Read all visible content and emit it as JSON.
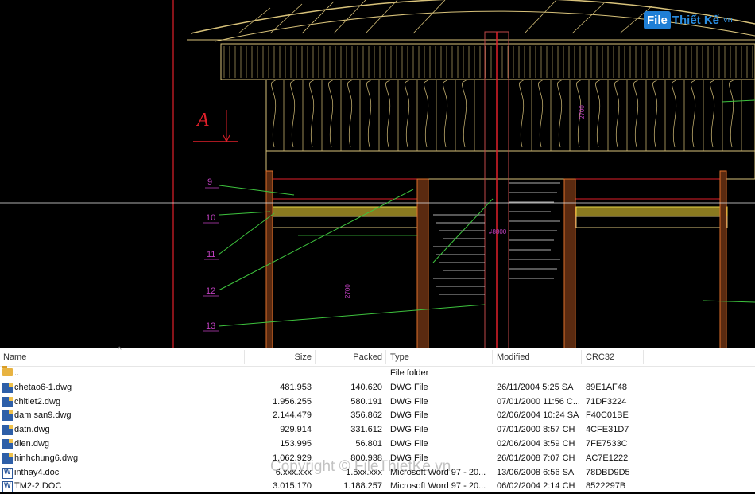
{
  "cad": {
    "section_label": "A",
    "callouts": [
      "9",
      "10",
      "11",
      "12",
      "13"
    ],
    "dim_texts": [
      "2700",
      "2700",
      "#8800"
    ],
    "colors": {
      "background": "#000000",
      "structure": "#d8c27a",
      "red": "#e0202a",
      "green": "#3ec43e",
      "white": "#e8e8e8",
      "magenta": "#c040c0"
    }
  },
  "logo": {
    "box": "File",
    "name": "Thiết Kế",
    "domain": ".vn"
  },
  "file_list": {
    "headers": {
      "name": "Name",
      "size": "Size",
      "packed": "Packed",
      "type": "Type",
      "modified": "Modified",
      "crc": "CRC32"
    },
    "rows": [
      {
        "icon": "folder-icon",
        "name": "..",
        "size": "",
        "packed": "",
        "type": "File folder",
        "modified": "",
        "crc": ""
      },
      {
        "icon": "dwg-icon",
        "name": "chetao6-1.dwg",
        "size": "481.953",
        "packed": "140.620",
        "type": "DWG File",
        "modified": "26/11/2004 5:25 SA",
        "crc": "89E1AF48"
      },
      {
        "icon": "dwg-icon",
        "name": "chitiet2.dwg",
        "size": "1.956.255",
        "packed": "580.191",
        "type": "DWG File",
        "modified": "07/01/2000 11:56 C...",
        "crc": "71DF3224"
      },
      {
        "icon": "dwg-icon",
        "name": "dam san9.dwg",
        "size": "2.144.479",
        "packed": "356.862",
        "type": "DWG File",
        "modified": "02/06/2004 10:24 SA",
        "crc": "F40C01BE"
      },
      {
        "icon": "dwg-icon",
        "name": "datn.dwg",
        "size": "929.914",
        "packed": "331.612",
        "type": "DWG File",
        "modified": "07/01/2000 8:57 CH",
        "crc": "4CFE31D7"
      },
      {
        "icon": "dwg-icon",
        "name": "dien.dwg",
        "size": "153.995",
        "packed": "56.801",
        "type": "DWG File",
        "modified": "02/06/2004 3:59 CH",
        "crc": "7FE7533C"
      },
      {
        "icon": "dwg-icon",
        "name": "hinhchung6.dwg",
        "size": "1.062.929",
        "packed": "800.938",
        "type": "DWG File",
        "modified": "26/01/2008 7:07 CH",
        "crc": "AC7E1222"
      },
      {
        "icon": "doc-icon",
        "name": "inthay4.doc",
        "size": "6.xxx.xxx",
        "packed": "1.5xx.xxx",
        "type": "Microsoft Word 97 - 20...",
        "modified": "13/06/2008 6:56 SA",
        "crc": "78DBD9D5"
      },
      {
        "icon": "doc-icon",
        "name": "TM2-2.DOC",
        "size": "3.015.170",
        "packed": "1.188.257",
        "type": "Microsoft Word 97 - 20...",
        "modified": "06/02/2004 2:14 CH",
        "crc": "8522297B"
      }
    ]
  },
  "watermark": "Copyright © FileThietKe.vn"
}
